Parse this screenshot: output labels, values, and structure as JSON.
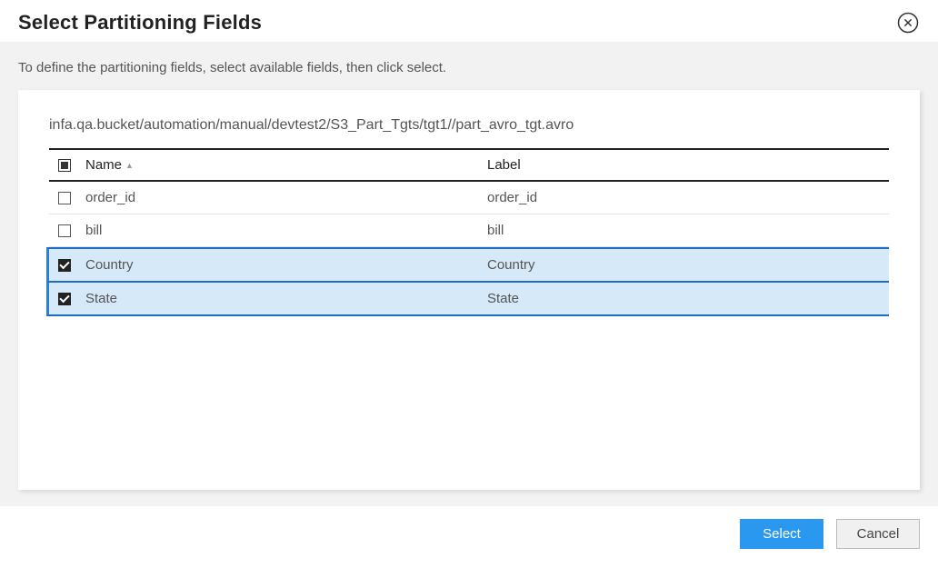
{
  "dialog": {
    "title": "Select Partitioning Fields",
    "subtitle": "To define the partitioning fields, select available fields, then click select."
  },
  "panel": {
    "path": "infa.qa.bucket/automation/manual/devtest2/S3_Part_Tgts/tgt1//part_avro_tgt.avro"
  },
  "table": {
    "headers": {
      "name": "Name",
      "label": "Label"
    },
    "rows": [
      {
        "name": "order_id",
        "label": "order_id",
        "checked": false
      },
      {
        "name": "bill",
        "label": "bill",
        "checked": false
      },
      {
        "name": "Country",
        "label": "Country",
        "checked": true
      },
      {
        "name": "State",
        "label": "State",
        "checked": true
      }
    ]
  },
  "footer": {
    "select": "Select",
    "cancel": "Cancel"
  }
}
